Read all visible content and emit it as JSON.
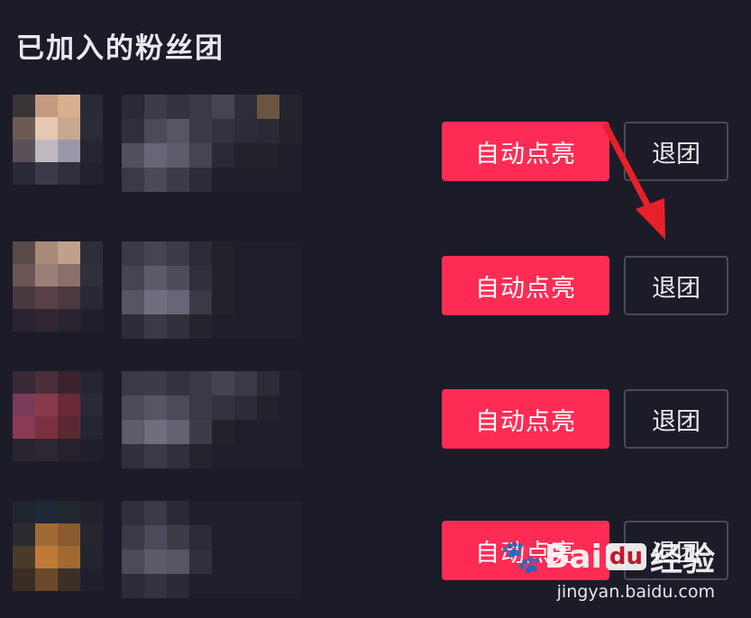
{
  "header": {
    "title": "已加入的粉丝团"
  },
  "rows": [
    {
      "light_label": "自动点亮",
      "quit_label": "退团"
    },
    {
      "light_label": "自动点亮",
      "quit_label": "退团"
    },
    {
      "light_label": "自动点亮",
      "quit_label": "退团"
    },
    {
      "light_label": "自动点亮",
      "quit_label": "退团"
    }
  ],
  "colors": {
    "background": "#1c1c29",
    "accent": "#fe2c55",
    "annotation_arrow": "#e8202a"
  },
  "watermark": {
    "logo_left": "Bai",
    "logo_du": "du",
    "logo_right": "经验",
    "url": "jingyan.baidu.com"
  }
}
